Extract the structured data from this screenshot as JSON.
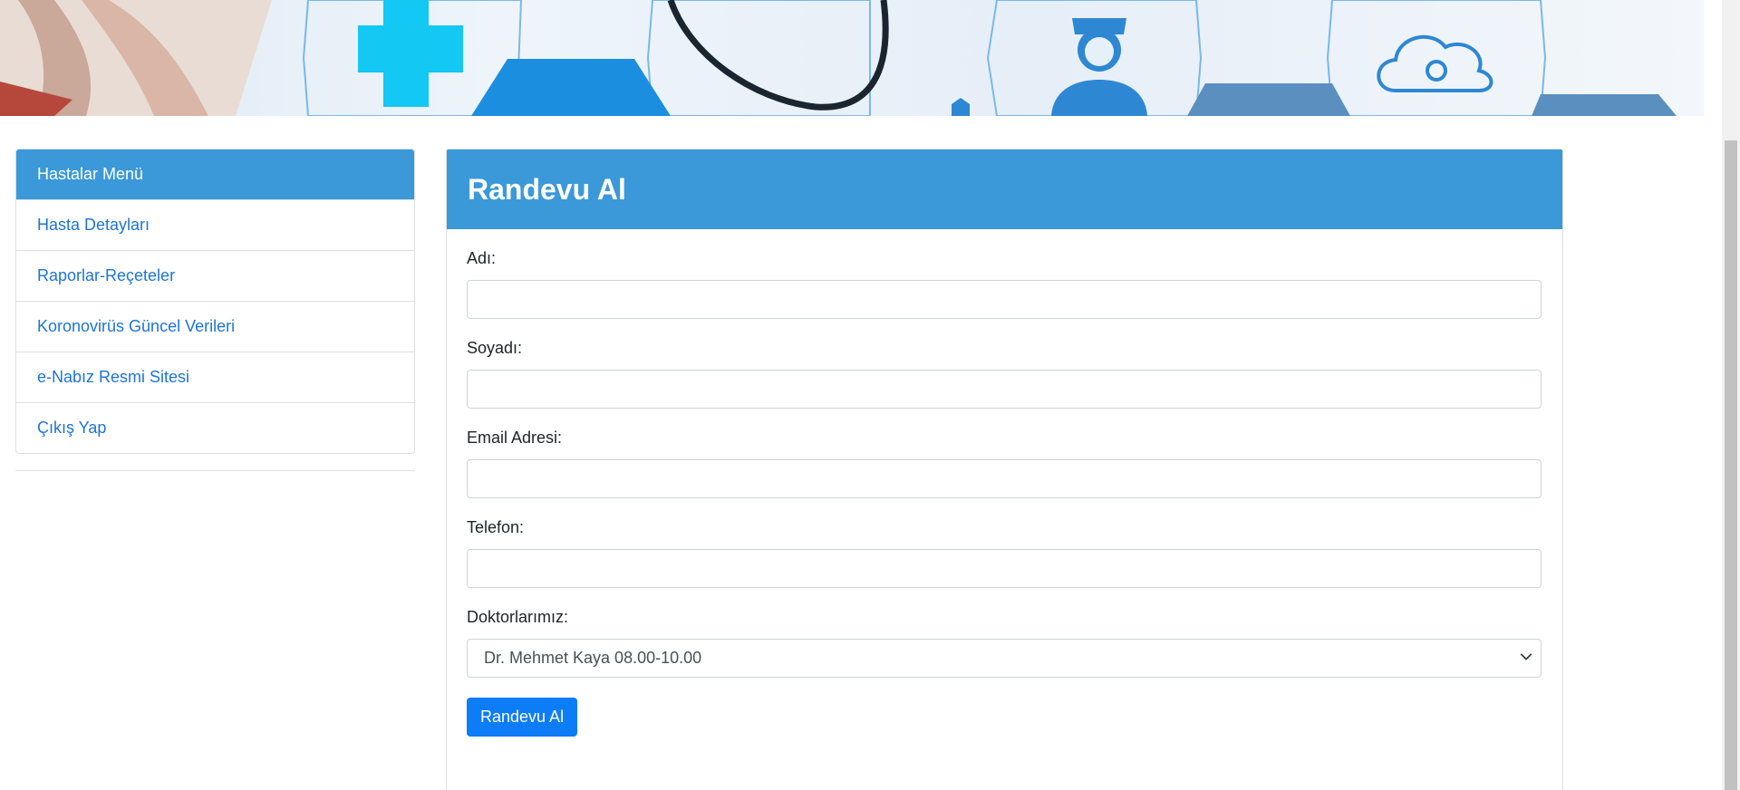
{
  "sidebar": {
    "items": [
      {
        "label": "Hastalar Menü",
        "active": true
      },
      {
        "label": "Hasta Detayları"
      },
      {
        "label": "Raporlar-Reçeteler"
      },
      {
        "label": "Koronovirüs Güncel Verileri"
      },
      {
        "label": "e-Nabız Resmi Sitesi"
      },
      {
        "label": "Çıkış Yap"
      }
    ]
  },
  "card": {
    "title": "Randevu Al",
    "fields": {
      "first_name": {
        "label": "Adı:",
        "value": ""
      },
      "last_name": {
        "label": "Soyadı:",
        "value": ""
      },
      "email": {
        "label": "Email Adresi:",
        "value": ""
      },
      "phone": {
        "label": "Telefon:",
        "value": ""
      },
      "doctor": {
        "label": "Doktorlarımız:",
        "selected": "Dr. Mehmet Kaya 08.00-10.00"
      }
    },
    "submit_label": "Randevu Al"
  },
  "colors": {
    "header_blue": "#3b99d9",
    "link_blue": "#1d74d8",
    "button_blue": "#0d7cf7"
  },
  "icons": [
    "medical-cross-icon",
    "stethoscope-icon",
    "nurse-icon",
    "cloud-gear-icon",
    "chevron-down-icon"
  ]
}
